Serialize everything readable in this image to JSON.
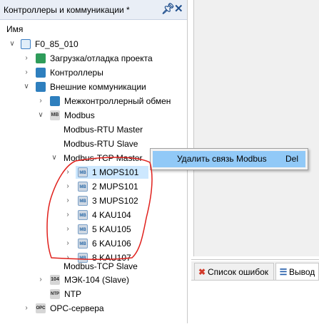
{
  "panel": {
    "title": "Контроллеры и коммуникации *",
    "column_header": "Имя"
  },
  "tree": [
    {
      "label": "F0_85_010",
      "icon": "device-icon",
      "expander": "expanded"
    },
    {
      "label": "Загрузка/отладка проекта",
      "icon": "load-debug-icon",
      "expander": "collapsed"
    },
    {
      "label": "Контроллеры",
      "icon": "controllers-icon",
      "expander": "collapsed"
    },
    {
      "label": "Внешние коммуникации",
      "icon": "external-comm-icon",
      "expander": "expanded"
    },
    {
      "label": "Межконтроллерный обмен",
      "icon": "inter-controller-icon",
      "expander": "collapsed"
    },
    {
      "label": "Modbus",
      "icon": "modbus-icon",
      "icon_text": "MB",
      "expander": "expanded"
    },
    {
      "label": "Modbus-RTU Master"
    },
    {
      "label": "Modbus-RTU Slave"
    },
    {
      "label": "Modbus-TCP Master",
      "expander": "expanded"
    },
    {
      "label": "1 MOPS101",
      "icon": "modbus-device-icon",
      "icon_text": "MB",
      "expander": "collapsed",
      "selected": true
    },
    {
      "label": "2 MUPS101",
      "icon": "modbus-device-icon",
      "icon_text": "MB",
      "expander": "collapsed"
    },
    {
      "label": "3 MUPS102",
      "icon": "modbus-device-icon",
      "icon_text": "MB",
      "expander": "collapsed"
    },
    {
      "label": "4 KAU104",
      "icon": "modbus-device-icon",
      "icon_text": "MB",
      "expander": "collapsed"
    },
    {
      "label": "5 KAU105",
      "icon": "modbus-device-icon",
      "icon_text": "MB",
      "expander": "collapsed"
    },
    {
      "label": "6 KAU106",
      "icon": "modbus-device-icon",
      "icon_text": "MB",
      "expander": "collapsed"
    },
    {
      "label": "8 KAU107",
      "icon": "modbus-device-icon",
      "icon_text": "MB",
      "expander": "collapsed"
    },
    {
      "label": "Modbus-TCP Slave"
    },
    {
      "label": "МЭК-104 (Slave)",
      "icon": "iec104-icon",
      "icon_text": "104",
      "expander": "collapsed"
    },
    {
      "label": "NTP",
      "icon": "ntp-icon",
      "icon_text": "NTP"
    },
    {
      "label": "OPC-сервера",
      "icon": "opc-icon",
      "icon_text": "OPC",
      "expander": "collapsed"
    }
  ],
  "context_menu": {
    "item_label": "Удалить связь Modbus",
    "shortcut": "Del"
  },
  "bottom_tabs": [
    {
      "label": "Список ошибок",
      "icon": "error-list-icon"
    },
    {
      "label": "Вывод",
      "icon": "output-icon"
    }
  ],
  "colors": {
    "header_bg": "#e9eef6",
    "selection": "#cde8ff",
    "menu_highlight": "#91c9f7",
    "annotation": "#e0201c"
  }
}
